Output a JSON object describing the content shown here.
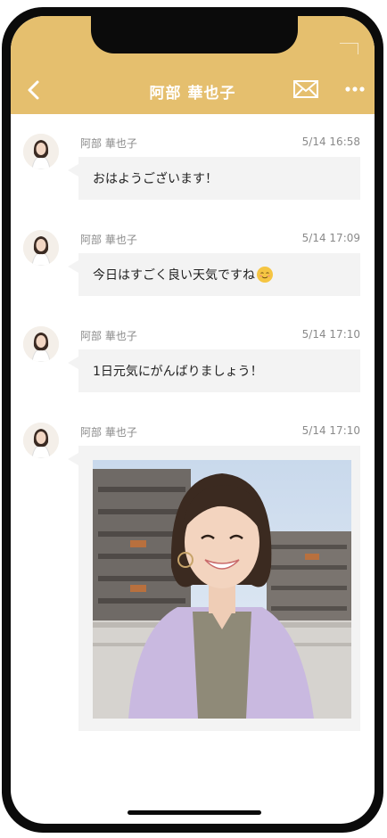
{
  "header": {
    "title": "阿部 華也子",
    "icons": {
      "back": "chevron-left-icon",
      "mail": "envelope-icon",
      "more": "more-dots-icon"
    }
  },
  "messages": [
    {
      "sender": "阿部 華也子",
      "time": "5/14 16:58",
      "text": "おはようございます！"
    },
    {
      "sender": "阿部 華也子",
      "time": "5/14 17:09",
      "text": "今日はすごく良い天気ですね",
      "emoji": "relieved-face-emoji"
    },
    {
      "sender": "阿部 華也子",
      "time": "5/14 17:10",
      "text": "1日元気にがんばりましょう！"
    },
    {
      "sender": "阿部 華也子",
      "time": "5/14 17:10",
      "image": "portrait-photo"
    }
  ],
  "colors": {
    "header": "#e5bf6e",
    "bubble": "#f3f3f3",
    "meta_text": "#8a8a8a"
  }
}
